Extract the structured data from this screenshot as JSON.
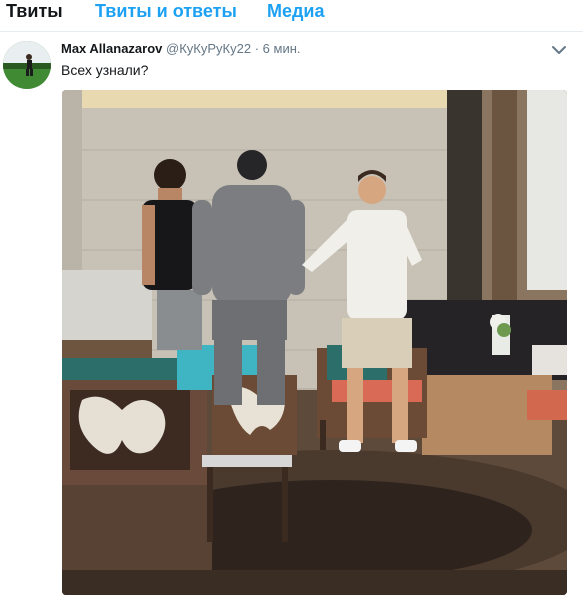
{
  "tabs": [
    {
      "label": "Твиты",
      "active": true
    },
    {
      "label": "Твиты и ответы",
      "active": false
    },
    {
      "label": "Медиа",
      "active": false
    }
  ],
  "tweet": {
    "author_name": "Max Allanazarov",
    "handle": "@КуКуРуКу22",
    "separator": "·",
    "time": "6 мин.",
    "text": "Всех узнали?"
  },
  "icons": {
    "caret": "chevron-down-icon",
    "avatar": "avatar",
    "media": "photo"
  },
  "colors": {
    "accent": "#1da1f2",
    "text": "#14171a",
    "secondary": "#657786"
  }
}
